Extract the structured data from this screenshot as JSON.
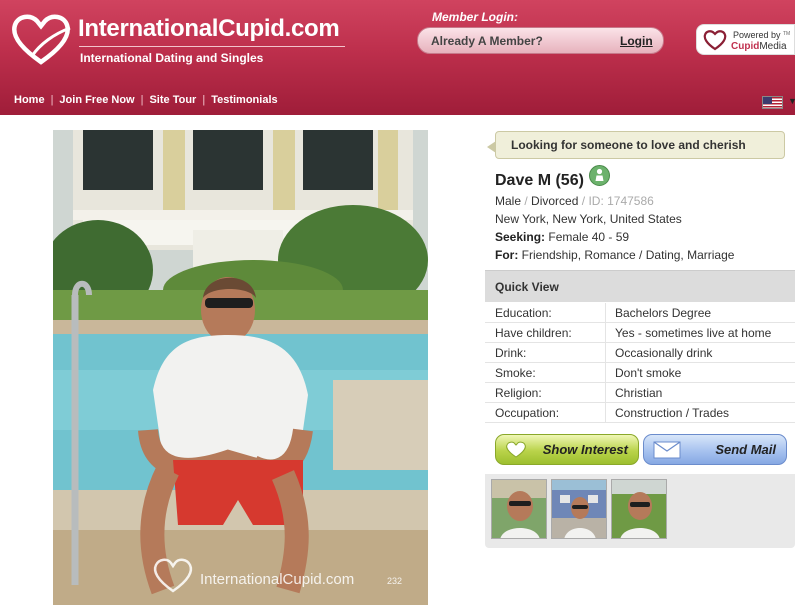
{
  "header": {
    "logo_text": "InternationalCupid.com",
    "tagline": "International Dating and Singles",
    "member_login_title": "Member Login:",
    "already_member": "Already A Member?",
    "login_link": "Login",
    "powered_by": "Powered by",
    "powered_name": "CupidMedia",
    "powered_name_brand": "Cupid",
    "powered_name_rest": "Media",
    "powered_tm": "TM",
    "nav": [
      "Home",
      "Join Free Now",
      "Site Tour",
      "Testimonials"
    ],
    "flag_icon": "us-flag-icon",
    "colors": {
      "header_top": "#d0435f",
      "header_bottom": "#9f1d39"
    }
  },
  "photo": {
    "watermark": "InternationalCupid.com",
    "photo_number": "232"
  },
  "profile": {
    "headline": "Looking for someone to love and cherish",
    "name": "Dave M (56)",
    "gender": "Male",
    "marital": "Divorced",
    "id_text": "ID: 1747586",
    "location": "New York, New York, United States",
    "seeking_label": "Seeking:",
    "seeking_value": "Female 40 - 59",
    "for_label": "For:",
    "for_value": "Friendship, Romance / Dating, Marriage",
    "online_icon": "person-online-icon"
  },
  "quick_view": {
    "title": "Quick View",
    "rows": [
      {
        "label": "Education:",
        "value": "Bachelors Degree"
      },
      {
        "label": "Have children:",
        "value": "Yes - sometimes live at home"
      },
      {
        "label": "Drink:",
        "value": "Occasionally drink"
      },
      {
        "label": "Smoke:",
        "value": "Don't smoke"
      },
      {
        "label": "Religion:",
        "value": "Christian"
      },
      {
        "label": "Occupation:",
        "value": "Construction / Trades"
      }
    ]
  },
  "actions": {
    "show_interest": "Show Interest",
    "send_mail": "Send Mail"
  }
}
